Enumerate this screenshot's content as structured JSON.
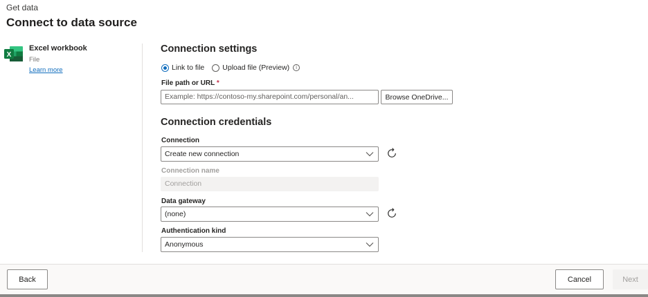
{
  "header": {
    "breadcrumb": "Get data",
    "title": "Connect to data source"
  },
  "source": {
    "icon": "excel-icon",
    "name": "Excel workbook",
    "category": "File",
    "learn_more": "Learn more",
    "icon_color": "#107c41"
  },
  "connection_settings": {
    "title": "Connection settings",
    "radio_link": "Link to file",
    "radio_upload": "Upload file (Preview)",
    "selected": "Link to file",
    "file_path_label": "File path or URL",
    "required_marker": "*",
    "file_path_placeholder": "Example: https://contoso-my.sharepoint.com/personal/an...",
    "browse_label": "Browse OneDrive..."
  },
  "connection_credentials": {
    "title": "Connection credentials",
    "connection_label": "Connection",
    "connection_value": "Create new connection",
    "connection_name_label": "Connection name",
    "connection_name_placeholder": "Connection",
    "gateway_label": "Data gateway",
    "gateway_value": "(none)",
    "auth_label": "Authentication kind",
    "auth_value": "Anonymous"
  },
  "footer": {
    "back_label": "Back",
    "cancel_label": "Cancel",
    "next_label": "Next"
  },
  "colors": {
    "accent": "#0f6cbd",
    "required": "#c4314b",
    "excel_green": "#107c41"
  }
}
